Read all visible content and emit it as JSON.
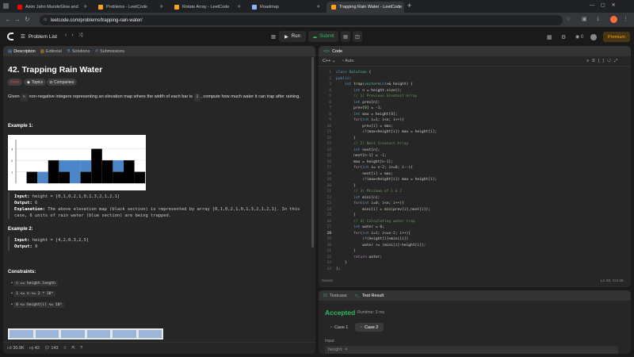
{
  "browser": {
    "tabs": [
      {
        "label": "Asim Jahn MundeSlow and",
        "color": "#ff0000"
      },
      {
        "label": "Problems - LeetCode",
        "color": "#ffa116"
      },
      {
        "label": "Rotate Array - LeetCode",
        "color": "#ffa116"
      },
      {
        "label": "Roadmap",
        "color": "#8ab4f8"
      },
      {
        "label": "Trapping Rain Water - LeetCode",
        "color": "#ffa116"
      }
    ],
    "url": "leetcode.com/problems/trapping-rain-water/"
  },
  "header": {
    "problem_list": "Problem List",
    "run": "Run",
    "submit": "Submit",
    "streak": "0",
    "premium": "Premium"
  },
  "left_tabs": {
    "description": "Description",
    "editorial": "Editorial",
    "solutions": "Solutions",
    "submissions": "Submissions"
  },
  "problem": {
    "title": "42. Trapping Rain Water",
    "difficulty": "Hard",
    "topics": "Topics",
    "companies": "Companies",
    "desc_pre": "Given ",
    "desc_n": "n",
    "desc_mid": " non-negative integers representing an elevation map where the width of each bar is ",
    "desc_one": "1",
    "desc_post": ", compute how much water it can trap after raining.",
    "ex1_title": "Example 1:",
    "ex1_input_label": "Input:",
    "ex1_input": "height = [0,1,0,2,1,0,1,3,2,1,2,1]",
    "ex1_output_label": "Output:",
    "ex1_output": "6",
    "ex1_expl_label": "Explanation:",
    "ex1_expl": "The above elevation map (black section) is represented by array [0,1,0,2,1,0,1,3,2,1,2,1]. In this case, 6 units of rain water (blue section) are being trapped.",
    "ex2_title": "Example 2:",
    "ex2_input_label": "Input:",
    "ex2_input": "height = [4,2,0,3,2,5]",
    "ex2_output_label": "Output:",
    "ex2_output": "9",
    "constraints_title": "Constraints:",
    "constraints": [
      "n == height.length",
      "1 <= n <= 2 * 10⁴",
      "0 <= height[i] <= 10⁵"
    ],
    "likes": "30.9K",
    "dislikes": "42",
    "comments": "143",
    "heights": [
      0,
      1,
      0,
      2,
      1,
      0,
      1,
      3,
      2,
      1,
      2,
      1
    ],
    "water": [
      0,
      0,
      1,
      0,
      1,
      2,
      1,
      0,
      0,
      1,
      0,
      0
    ],
    "axis_ticks": [
      "3",
      "2",
      "1"
    ],
    "bar_color": "#000000",
    "water_color": "#4a86c8"
  },
  "code": {
    "title": "Code",
    "lang": "C++",
    "auto": "Auto",
    "saved": "Saved",
    "cursor": "Ln 28, Col 25",
    "line_numbers": [
      "1",
      "2",
      "3",
      "4",
      "5",
      "6",
      "7",
      "8",
      "9",
      "10",
      "11",
      "12",
      "13",
      "14",
      "15",
      "16",
      "17",
      "18",
      "19",
      "20",
      "21",
      "22",
      "23",
      "24",
      "25",
      "26",
      "27",
      "28",
      "29",
      "30",
      "31",
      "32",
      "33",
      "34"
    ]
  },
  "result": {
    "testcase_tab": "Testcase",
    "result_tab": "Test Result",
    "status": "Accepted",
    "runtime": "Runtime: 3 ms",
    "case1": "Case 1",
    "case2": "Case 2",
    "input_label": "Input",
    "input_value": "height ="
  }
}
